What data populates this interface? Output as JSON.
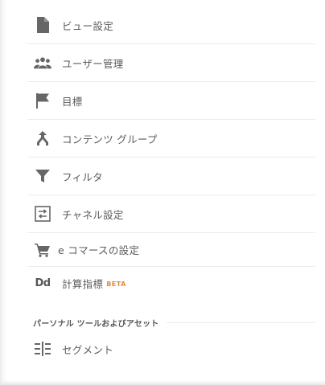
{
  "menu": {
    "items": [
      {
        "label": "ビュー設定",
        "icon": "document-icon"
      },
      {
        "label": "ユーザー管理",
        "icon": "users-icon"
      },
      {
        "label": "目標",
        "icon": "flag-icon"
      },
      {
        "label": "コンテンツ グループ",
        "icon": "content-grouping-icon"
      },
      {
        "label": "フィルタ",
        "icon": "filter-icon"
      },
      {
        "label": "チャネル設定",
        "icon": "channel-settings-icon"
      },
      {
        "label": "e コマースの設定",
        "icon": "cart-icon"
      },
      {
        "label": "計算指標",
        "badge": "BETA",
        "icon_text": "Dd",
        "icon": "calculated-metrics-icon"
      }
    ],
    "section": {
      "title": "パーソナル ツールおよびアセット"
    },
    "section_items": [
      {
        "label": "セグメント",
        "icon": "segments-icon"
      }
    ]
  },
  "colors": {
    "text": "#5a5a5a",
    "icon": "#666666",
    "beta": "#e0883a",
    "divider": "#ececec"
  }
}
